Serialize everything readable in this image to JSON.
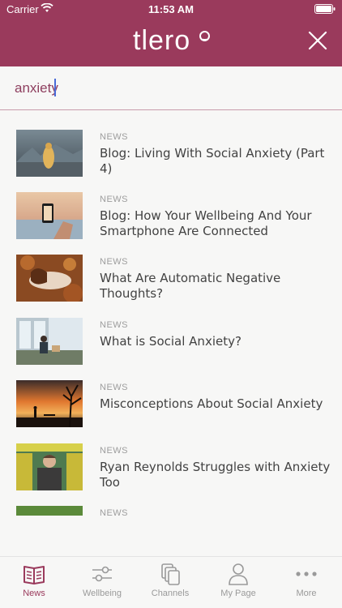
{
  "status": {
    "carrier": "Carrier",
    "time": "11:53 AM"
  },
  "header": {
    "logo_text": "tlero",
    "close_icon": "close-icon",
    "color": "#9a3a5c"
  },
  "search": {
    "value": "anxiety",
    "placeholder": ""
  },
  "results": [
    {
      "tag": "NEWS",
      "title": "Blog: Living With Social Anxiety (Part 4)"
    },
    {
      "tag": "NEWS",
      "title": "Blog: How Your Wellbeing And Your Smartphone Are Connected"
    },
    {
      "tag": "NEWS",
      "title": "What Are Automatic Negative Thoughts?"
    },
    {
      "tag": "NEWS",
      "title": "What is Social Anxiety?"
    },
    {
      "tag": "NEWS",
      "title": "Misconceptions About Social Anxiety"
    },
    {
      "tag": "NEWS",
      "title": "Ryan Reynolds Struggles with Anxiety Too"
    },
    {
      "tag": "NEWS",
      "title": ""
    }
  ],
  "tabs": [
    {
      "label": "News",
      "icon": "book-icon",
      "active": true
    },
    {
      "label": "Wellbeing",
      "icon": "sliders-icon",
      "active": false
    },
    {
      "label": "Channels",
      "icon": "copy-icon",
      "active": false
    },
    {
      "label": "My Page",
      "icon": "person-icon",
      "active": false
    },
    {
      "label": "More",
      "icon": "more-icon",
      "active": false
    }
  ]
}
